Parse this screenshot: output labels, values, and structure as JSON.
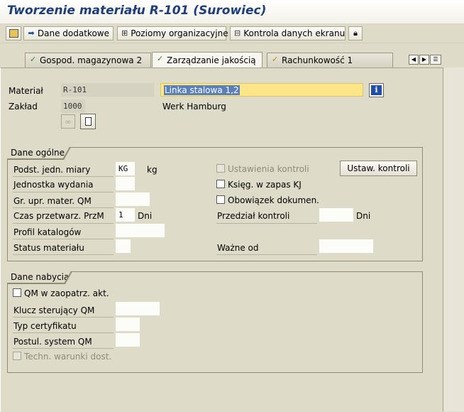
{
  "window": {
    "title": "Tworzenie materiału R-101 (Surowiec)"
  },
  "toolbar": {
    "buttons": [
      {
        "label": "",
        "icon": "save-icon"
      },
      {
        "label": "Dane dodatkowe",
        "icon": "arrow-right-icon"
      },
      {
        "label": "Poziomy organizacyjne",
        "icon": "org-levels-icon"
      },
      {
        "label": "Kontrola danych ekranu",
        "icon": "screen-check-icon"
      },
      {
        "label": "",
        "icon": "lock-icon"
      }
    ]
  },
  "tabs": [
    {
      "label": "Gospod. magazynowa 2",
      "icon": "check-leaf-icon",
      "active": false
    },
    {
      "label": "Zarządzanie jakością",
      "icon": "check-leaf-icon",
      "active": true
    },
    {
      "label": "Rachunkowość 1",
      "icon": "check-leaf-icon",
      "active": false
    }
  ],
  "header": {
    "material_label": "Materiał",
    "material_value": "R-101",
    "material_desc": "Linka stalowa 1,2",
    "plant_label": "Zakład",
    "plant_value": "1000",
    "plant_desc": "Werk Hamburg"
  },
  "general": {
    "title": "Dane ogólne",
    "base_uom_label": "Podst. jedn. miary",
    "base_uom_value": "KG",
    "base_uom_text": "kg",
    "issue_unit_label": "Jednostka wydania",
    "qm_group_label": "Gr. upr. mater. QM",
    "proc_time_label": "Czas przetwarz. PrzM",
    "proc_time_value": "1",
    "proc_time_unit": "Dni",
    "catalog_profile_label": "Profil katalogów",
    "material_status_label": "Status materiału",
    "inspection_settings_label": "Ustawienia kontroli",
    "post_insp_stock_label": "Księg. w zapas KJ",
    "doc_required_label": "Obowiązek dokumen.",
    "inspection_interval_label": "Przedział kontroli",
    "inspection_interval_unit": "Dni",
    "valid_from_label": "Ważne od",
    "settings_button": "Ustaw. kontroli"
  },
  "procurement": {
    "title": "Dane nabycia",
    "qm_active_label": "QM w zaopatrz. akt.",
    "qm_control_key_label": "Klucz sterujący QM",
    "cert_type_label": "Typ certyfikatu",
    "qm_system_label": "Postul. system QM",
    "tech_delivery_label": "Techn. warunki dost."
  },
  "colors": {
    "title": "#1c3e7a",
    "background": "#dedbc9",
    "selected_field": "#fde68a"
  }
}
